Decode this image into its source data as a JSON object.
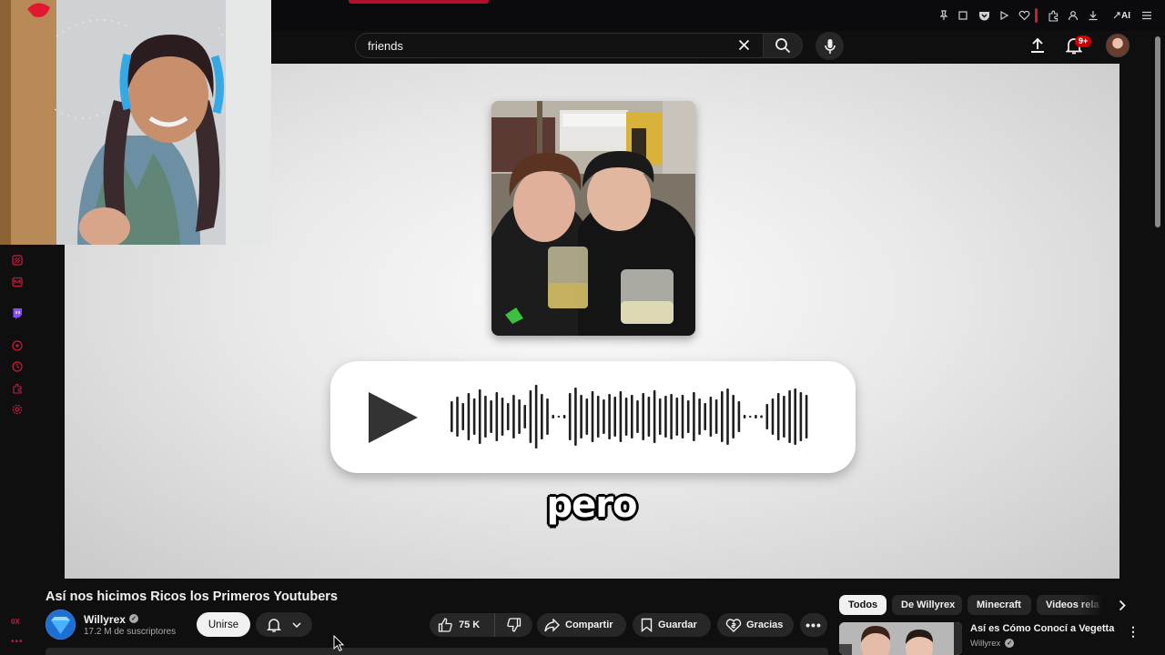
{
  "search": {
    "value": "friends"
  },
  "header": {
    "notification_count": "9+"
  },
  "extensions": {
    "ai_label": "AI"
  },
  "video": {
    "caption": "pero"
  },
  "rail": {
    "bottom_label": "0X"
  },
  "watch": {
    "title": "Así nos hicimos Ricos los Primeros Youtubers",
    "channel": "Willyrex",
    "subscribers": "17.2 M de suscriptores",
    "join_label": "Unirse",
    "likes": "75 K",
    "share_label": "Compartir",
    "save_label": "Guardar",
    "thanks_label": "Gracias"
  },
  "chips": [
    "Todos",
    "De Willyrex",
    "Minecraft",
    "Videos rela"
  ],
  "recommended": {
    "title": "Así es Cómo Conocí a Vegetta",
    "channel": "Willyrex"
  },
  "colors": {
    "accent": "#cc1a3c",
    "background": "#0f0f0f",
    "notification_badge": "#cc0000"
  }
}
